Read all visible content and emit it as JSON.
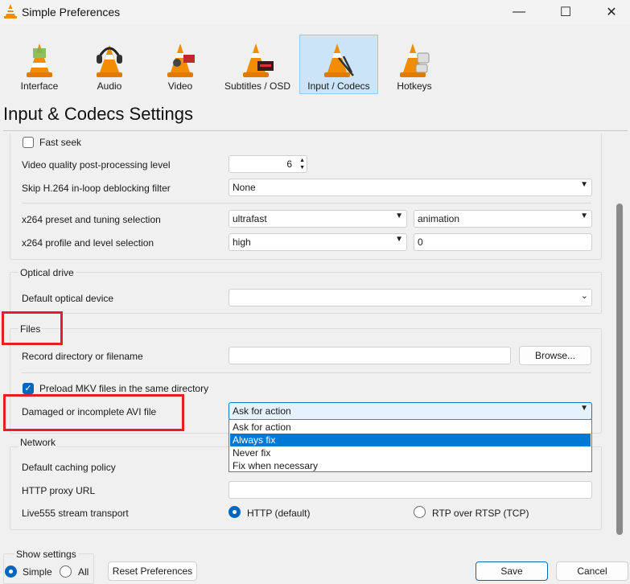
{
  "window": {
    "title": "Simple Preferences",
    "minimize_glyph": "—",
    "maximize_glyph": "☐",
    "close_glyph": "✕"
  },
  "toolbar": {
    "items": [
      {
        "label": "Interface",
        "icon": "cone-interface-icon",
        "active": false
      },
      {
        "label": "Audio",
        "icon": "cone-headphones-icon",
        "active": false
      },
      {
        "label": "Video",
        "icon": "cone-video-icon",
        "active": false
      },
      {
        "label": "Subtitles / OSD",
        "icon": "cone-subtitles-icon",
        "active": false
      },
      {
        "label": "Input / Codecs",
        "icon": "cone-codecs-icon",
        "active": true
      },
      {
        "label": "Hotkeys",
        "icon": "cone-hotkeys-icon",
        "active": false
      }
    ]
  },
  "page_title": "Input & Codecs Settings",
  "codecs": {
    "fast_seek": {
      "label": "Fast seek",
      "checked": false
    },
    "video_quality": {
      "label": "Video quality post-processing level",
      "value": "6"
    },
    "skip_h264": {
      "label": "Skip H.264 in-loop deblocking filter",
      "value": "None"
    },
    "x264_preset": {
      "label": "x264 preset and tuning selection",
      "preset": "ultrafast",
      "tuning": "animation"
    },
    "x264_profile": {
      "label": "x264 profile and level selection",
      "profile": "high",
      "level": "0"
    }
  },
  "optical": {
    "group_label": "Optical drive",
    "device_label": "Default optical device",
    "device_value": ""
  },
  "files": {
    "group_label": "Files",
    "record_label": "Record directory or filename",
    "record_value": "",
    "browse_label": "Browse...",
    "preload_mkv": {
      "label": "Preload MKV files in the same directory",
      "checked": true
    },
    "damaged_avi": {
      "label": "Damaged or incomplete AVI file",
      "value": "Ask for action",
      "options": [
        "Ask for action",
        "Always fix",
        "Never fix",
        "Fix when necessary"
      ],
      "highlighted": "Always fix"
    }
  },
  "network": {
    "group_label": "Network",
    "caching_label": "Default caching policy",
    "proxy_label": "HTTP proxy URL",
    "proxy_value": "",
    "live555_label": "Live555 stream transport",
    "http_option": "HTTP (default)",
    "rtp_option": "RTP over RTSP (TCP)",
    "selected": "HTTP (default)"
  },
  "bottom": {
    "show_settings_label": "Show settings",
    "simple_label": "Simple",
    "all_label": "All",
    "selected": "Simple",
    "reset_label": "Reset Preferences",
    "save_label": "Save",
    "cancel_label": "Cancel"
  },
  "colors": {
    "highlight_box": "#e3202a",
    "accent": "#0078d4",
    "active_tab_bg": "#cce4f7"
  }
}
